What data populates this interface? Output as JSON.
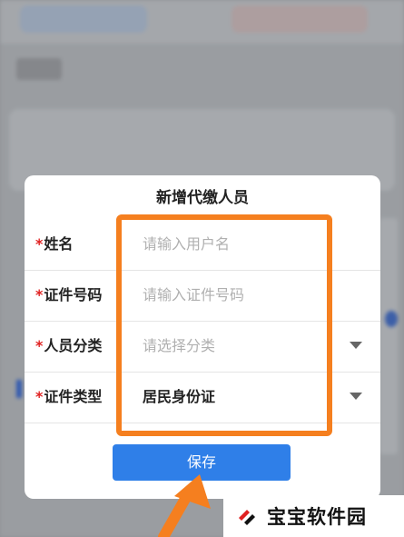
{
  "dialog": {
    "title": "新增代缴人员",
    "fields": [
      {
        "required_mark": "*",
        "label": "姓名",
        "value": "请输入用户名",
        "filled": false,
        "has_dropdown": false
      },
      {
        "required_mark": "*",
        "label": "证件号码",
        "value": "请输入证件号码",
        "filled": false,
        "has_dropdown": false
      },
      {
        "required_mark": "*",
        "label": "人员分类",
        "value": "请选择分类",
        "filled": false,
        "has_dropdown": true
      },
      {
        "required_mark": "*",
        "label": "证件类型",
        "value": "居民身份证",
        "filled": true,
        "has_dropdown": true
      }
    ],
    "save_label": "保存"
  },
  "watermark": {
    "text": "宝宝软件园"
  },
  "colors": {
    "accent": "#2f7fe8",
    "annotation": "#f57f1f",
    "required": "#e02020"
  }
}
